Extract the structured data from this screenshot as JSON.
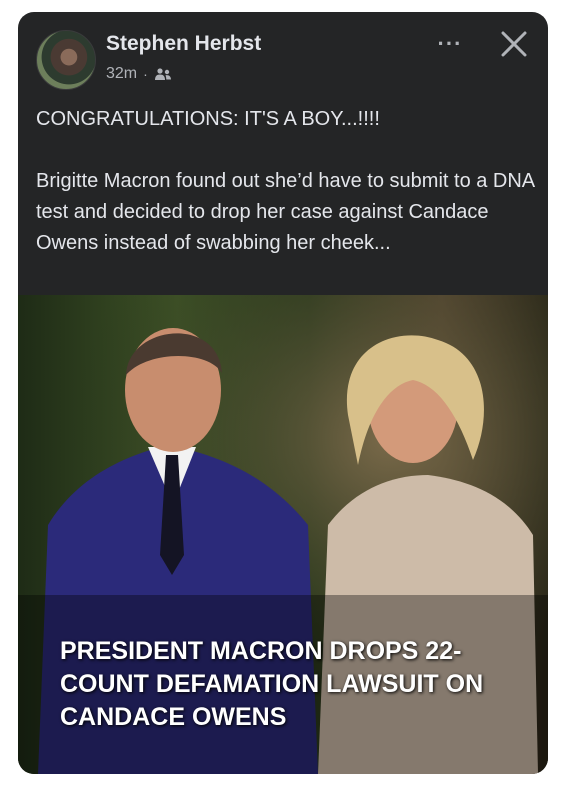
{
  "post": {
    "author": "Stephen Herbst",
    "time": "32m",
    "separator": "·",
    "audience_icon": "friends-icon",
    "more_label": "···",
    "headline": "CONGRATULATIONS: IT'S A BOY...!!!!",
    "body": "Brigitte Macron found out she’d have to submit to a DNA test and decided to drop her case against Candace Owens instead of swabbing her cheek..."
  },
  "image": {
    "caption": "PRESIDENT MACRON DROPS 22-COUNT DEFAMATION LAWSUIT ON CANDACE OWENS"
  },
  "colors": {
    "card_background": "#242526",
    "primary_text": "#e4e6eb",
    "secondary_text": "#b0b3b8"
  }
}
